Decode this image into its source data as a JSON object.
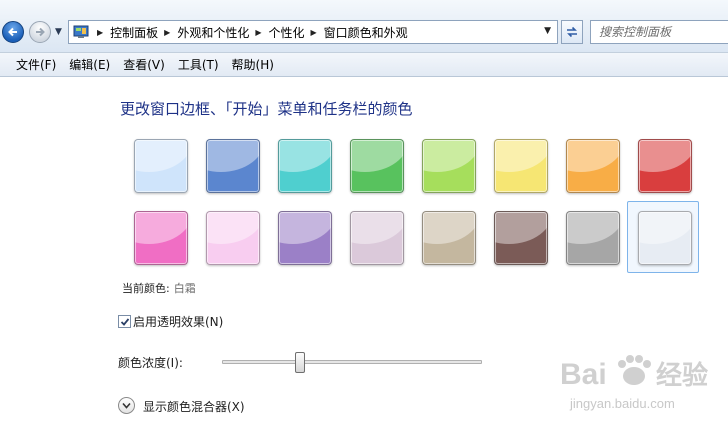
{
  "addressbar": {
    "breadcrumbs": [
      "控制面板",
      "外观和个性化",
      "个性化",
      "窗口颜色和外观"
    ],
    "search_placeholder": "搜索控制面板"
  },
  "menubar": {
    "items": [
      "文件(F)",
      "编辑(E)",
      "查看(V)",
      "工具(T)",
      "帮助(H)"
    ]
  },
  "main": {
    "title": "更改窗口边框、「开始」菜单和任务栏的颜色",
    "colors": [
      {
        "color": "#cfe4fb"
      },
      {
        "color": "#5b86cf"
      },
      {
        "color": "#4fcfcf"
      },
      {
        "color": "#58c25e"
      },
      {
        "color": "#a6de5c"
      },
      {
        "color": "#f6e673"
      },
      {
        "color": "#f8ad46"
      },
      {
        "color": "#d93e3e"
      },
      {
        "color": "#f06ec4"
      },
      {
        "color": "#f8cdf0"
      },
      {
        "color": "#9b80c7"
      },
      {
        "color": "#dbc9da"
      },
      {
        "color": "#c4b79f"
      },
      {
        "color": "#7b5b57"
      },
      {
        "color": "#a6a6a6"
      },
      {
        "color": "#e7ecf3"
      }
    ],
    "selected_index": 15,
    "current_color_label": "当前颜色:",
    "current_color_value": "白霜",
    "transparency_label": "启用透明效果(N)",
    "transparency_checked": true,
    "intensity_label": "颜色浓度(I):",
    "intensity_fraction": 0.3,
    "mixer_label": "显示颜色混合器(X)"
  },
  "watermark": {
    "text": "Baidu经验",
    "url": "jingyan.baidu.com"
  }
}
